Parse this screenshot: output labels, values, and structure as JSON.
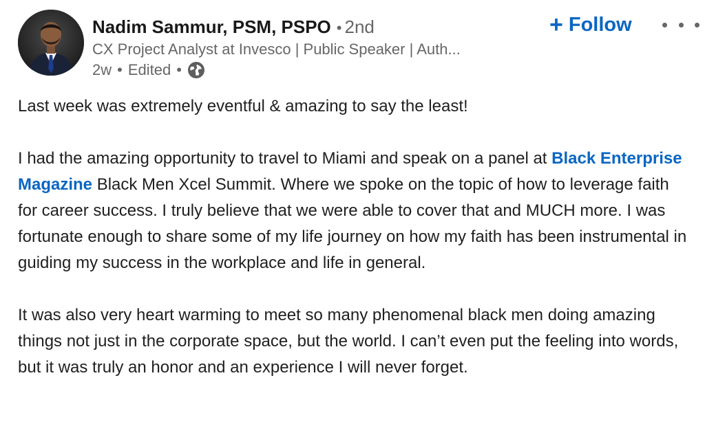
{
  "author": {
    "name": "Nadim Sammur, PSM, PSPO",
    "degree": "2nd",
    "headline": "CX Project Analyst at Invesco | Public Speaker | Auth...",
    "timestamp": "2w",
    "edited_label": "Edited",
    "visibility_icon": "globe-icon"
  },
  "follow_button": {
    "plus": "+",
    "label": "Follow"
  },
  "more_icon": "ellipsis-icon",
  "post": {
    "p1": "Last week was extremely eventful & amazing to say the least!",
    "p2_before": "I had the amazing opportunity to travel to Miami and speak on a panel at ",
    "p2_mention": "Black Enterprise Magazine",
    "p2_after": " Black Men Xcel Summit. Where we spoke on the topic of how to leverage faith for career success. I truly believe that we were able to cover that and MUCH more. I was fortunate enough to share some of my life journey on how my faith has been instrumental in guiding my success in the workplace and life in general.",
    "p3": "It was also very heart warming to meet so many phenomenal black men doing amazing things not just in the corporate space, but the world. I can’t even put the feeling into words, but it was truly an honor and an experience I will never forget."
  },
  "colors": {
    "link": "#0a66c2",
    "muted": "#666666",
    "text": "#1f1f1f"
  }
}
